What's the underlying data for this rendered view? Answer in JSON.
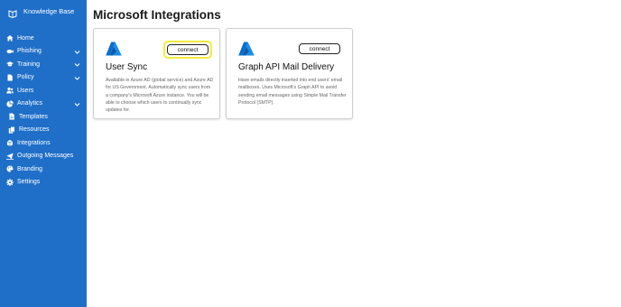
{
  "sidebar": {
    "brand": "Knowledge Base",
    "items": [
      {
        "label": "Home",
        "icon": "home-icon",
        "has_chevron": false
      },
      {
        "label": "Phishing",
        "icon": "fish-icon",
        "has_chevron": true
      },
      {
        "label": "Training",
        "icon": "graduation-cap-icon",
        "has_chevron": true
      },
      {
        "label": "Policy",
        "icon": "file-icon",
        "has_chevron": true
      },
      {
        "label": "Users",
        "icon": "users-icon",
        "has_chevron": false
      },
      {
        "label": "Analytics",
        "icon": "chart-pie-icon",
        "has_chevron": true
      },
      {
        "label": "Templates",
        "icon": "document-icon",
        "has_chevron": false
      },
      {
        "label": "Resources",
        "icon": "copy-icon",
        "has_chevron": false
      },
      {
        "label": "Integrations",
        "icon": "box-icon",
        "has_chevron": false
      },
      {
        "label": "Outgoing Messages",
        "icon": "paper-plane-icon",
        "has_chevron": false
      },
      {
        "label": "Branding",
        "icon": "palette-icon",
        "has_chevron": false
      },
      {
        "label": "Settings",
        "icon": "gear-icon",
        "has_chevron": false
      }
    ]
  },
  "main": {
    "title": "Microsoft Integrations",
    "cards": [
      {
        "title": "User Sync",
        "button": "connect",
        "description": "Available in Azure AD (global service) and Azure AD for US Government. Automatically sync users from a company's Microsoft Azure instance. You will be able to choose which users to continually sync updates for."
      },
      {
        "title": "Graph API Mail Delivery",
        "button": "connect",
        "description": "Have emails directly inserted into end users' email mailboxes. Uses Microsoft's Graph API to avoid sending email messages using Simple Mail Transfer Protocol (SMTP)."
      }
    ]
  },
  "colors": {
    "sidebar": "#1f6fc8",
    "highlight": "#f3ec3a",
    "azure": "#0a6ccf"
  }
}
